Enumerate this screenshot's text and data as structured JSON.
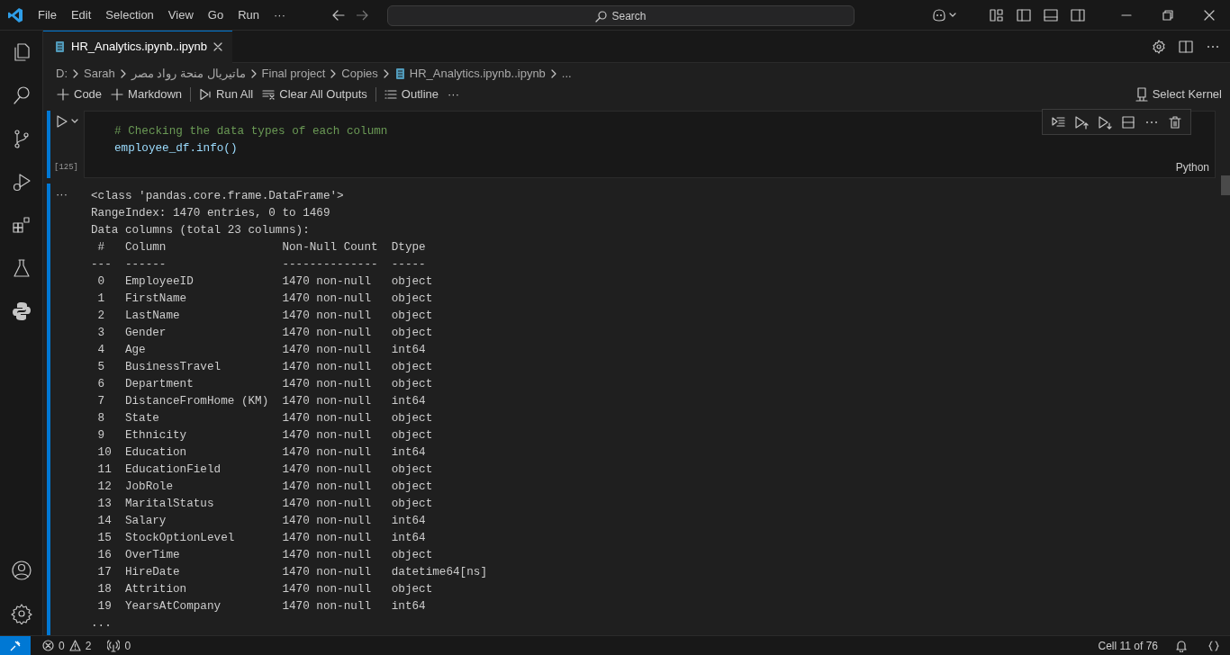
{
  "title_bar": {
    "menu": [
      "File",
      "Edit",
      "Selection",
      "View",
      "Go",
      "Run",
      "···"
    ],
    "search": {
      "placeholder": "Search"
    }
  },
  "tabs": [
    {
      "label": "HR_Analytics.ipynb..ipynb",
      "selected": true
    }
  ],
  "breadcrumb": [
    {
      "label": "D:",
      "kind": "folder"
    },
    {
      "label": "Sarah",
      "kind": "folder"
    },
    {
      "label": "ماتيريال منحة رواد مصر",
      "kind": "folder"
    },
    {
      "label": "Final project",
      "kind": "folder"
    },
    {
      "label": "Copies",
      "kind": "folder"
    },
    {
      "label": "HR_Analytics.ipynb..ipynb",
      "kind": "file"
    },
    {
      "label": "...",
      "kind": "more"
    }
  ],
  "toolbar": {
    "groups": [
      {
        "items": [
          {
            "label": "Code",
            "kind": "add"
          },
          {
            "label": "Markdown",
            "kind": "add"
          }
        ]
      },
      {
        "items": [
          {
            "label": "Run All",
            "kind": "run"
          },
          {
            "label": "Clear All Outputs",
            "kind": "clear"
          }
        ]
      },
      {
        "items": [
          {
            "label": "Outline",
            "kind": "outline"
          },
          {
            "label": "···",
            "kind": "more"
          }
        ]
      }
    ],
    "kernel": "Select Kernel"
  },
  "cell": {
    "execution_count": "[125]",
    "language": "Python",
    "lines": [
      {
        "text": "# Checking the data types of each column",
        "kind": "comment"
      },
      {
        "text": "employee_df.info()",
        "kind": "code"
      }
    ]
  },
  "output": {
    "more": "···",
    "lines": [
      "<class 'pandas.core.frame.DataFrame'>",
      "RangeIndex: 1470 entries, 0 to 1469",
      "Data columns (total 23 columns):",
      " #   Column                 Non-Null Count  Dtype",
      "---  ------                 --------------  -----",
      " 0   EmployeeID             1470 non-null   object",
      " 1   FirstName              1470 non-null   object",
      " 2   LastName               1470 non-null   object",
      " 3   Gender                 1470 non-null   object",
      " 4   Age                    1470 non-null   int64",
      " 5   BusinessTravel         1470 non-null   object",
      " 6   Department             1470 non-null   object",
      " 7   DistanceFromHome (KM)  1470 non-null   int64",
      " 8   State                  1470 non-null   object",
      " 9   Ethnicity              1470 non-null   object",
      " 10  Education              1470 non-null   int64",
      " 11  EducationField         1470 non-null   object",
      " 12  JobRole                1470 non-null   object",
      " 13  MaritalStatus          1470 non-null   object",
      " 14  Salary                 1470 non-null   int64",
      " 15  StockOptionLevel       1470 non-null   int64",
      " 16  OverTime               1470 non-null   object",
      " 17  HireDate               1470 non-null   datetime64[ns]",
      " 18  Attrition              1470 non-null   object",
      " 19  YearsAtCompany         1470 non-null   int64",
      "..."
    ]
  },
  "status_bar": {
    "errors": "0",
    "warnings": "2",
    "ports": "0",
    "cell_position": "Cell 11 of 76"
  }
}
